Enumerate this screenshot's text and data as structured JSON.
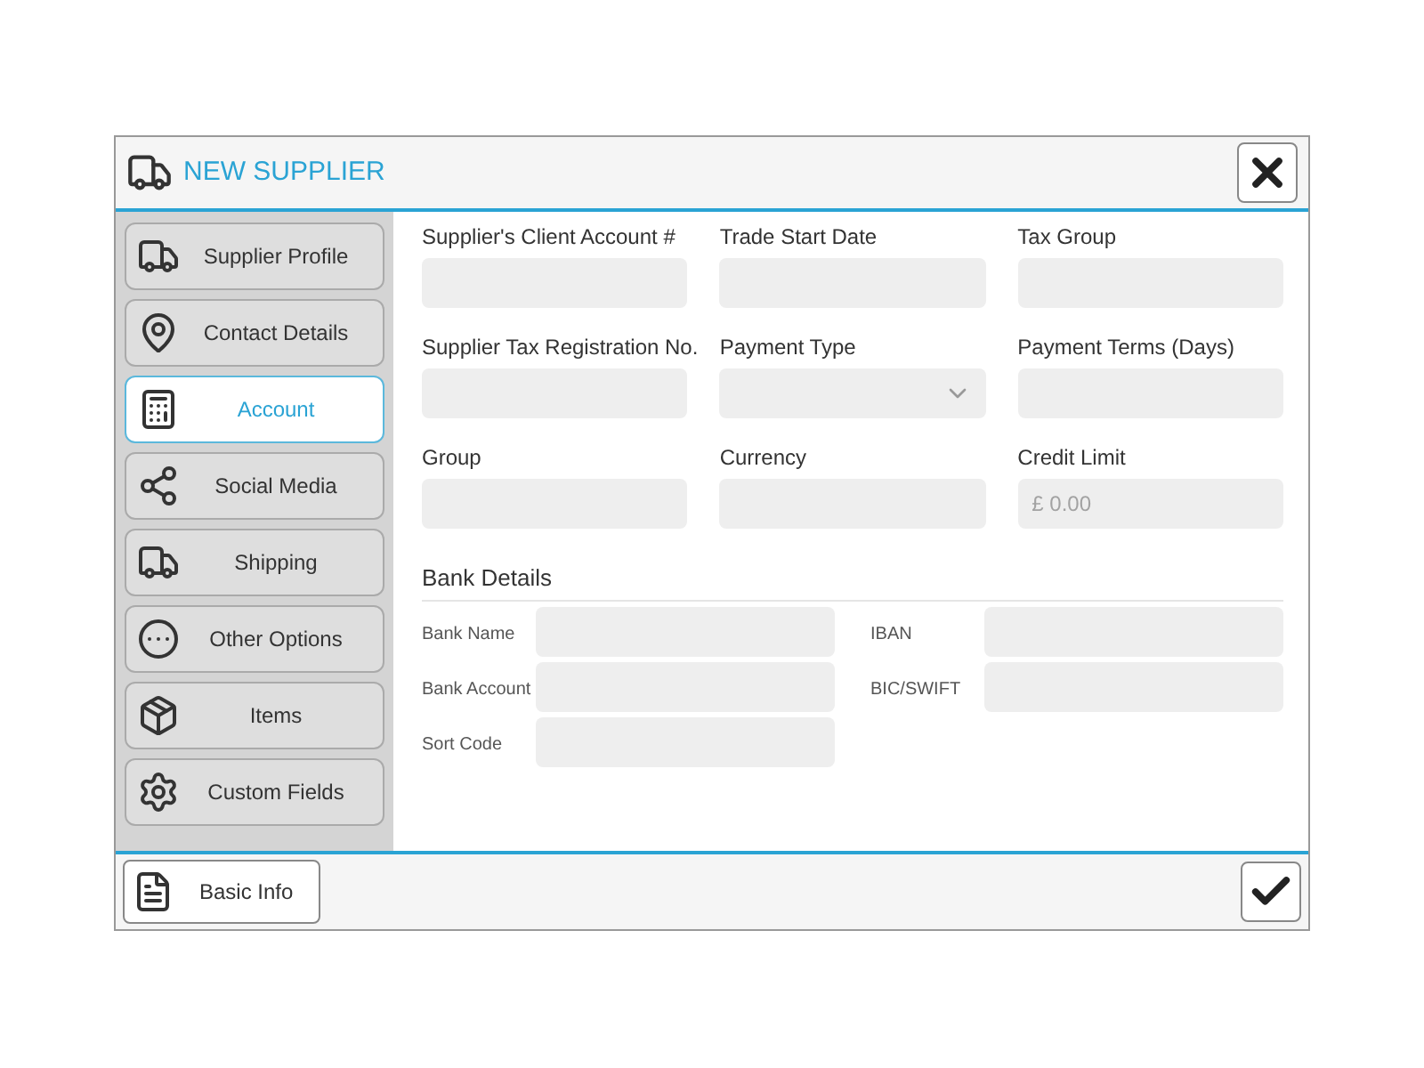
{
  "dialog": {
    "title": "NEW SUPPLIER"
  },
  "sidebar": {
    "items": [
      {
        "label": "Supplier Profile",
        "selected": false
      },
      {
        "label": "Contact Details",
        "selected": false
      },
      {
        "label": "Account",
        "selected": true
      },
      {
        "label": "Social Media",
        "selected": false
      },
      {
        "label": "Shipping",
        "selected": false
      },
      {
        "label": "Other Options",
        "selected": false
      },
      {
        "label": "Items",
        "selected": false
      },
      {
        "label": "Custom Fields",
        "selected": false
      }
    ]
  },
  "fields": [
    {
      "label": "Supplier's Client Account #",
      "kind": "text"
    },
    {
      "label": "Trade Start Date",
      "kind": "text"
    },
    {
      "label": "Tax Group",
      "kind": "text"
    },
    {
      "label": "Supplier Tax Registration No.",
      "kind": "text"
    },
    {
      "label": "Payment Type",
      "kind": "select"
    },
    {
      "label": "Payment Terms (Days)",
      "kind": "text"
    },
    {
      "label": "Group",
      "kind": "text"
    },
    {
      "label": "Currency",
      "kind": "text"
    },
    {
      "label": "Credit Limit",
      "kind": "text",
      "placeholder": "£ 0.00"
    }
  ],
  "bank_details": {
    "title": "Bank Details",
    "fields": [
      {
        "label": "Bank Name"
      },
      {
        "label": "IBAN"
      },
      {
        "label": "Bank Account"
      },
      {
        "label": "BIC/SWIFT"
      },
      {
        "label": "Sort Code"
      }
    ]
  },
  "footer": {
    "button": "Basic Info"
  }
}
